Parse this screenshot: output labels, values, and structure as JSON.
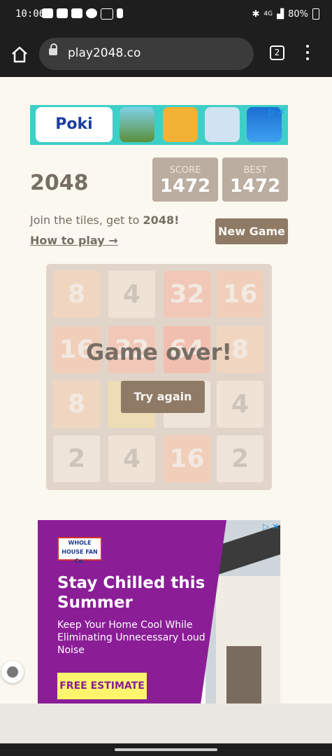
{
  "status": {
    "time": "10:06",
    "battery": "80%",
    "network": "4G"
  },
  "browser": {
    "url": "play2048.co",
    "tab_count": "2"
  },
  "ad_top": {
    "brand": "Poki",
    "adchoices": "▷ ✕"
  },
  "game": {
    "title": "2048",
    "score_label": "SCORE",
    "score": "1472",
    "best_label": "BEST",
    "best": "1472",
    "intro_text": "Join the tiles, get to ",
    "intro_goal": "2048!",
    "how_to": "How to play →",
    "new_game": "New Game",
    "game_over": "Game over!",
    "try_again": "Try again",
    "board": [
      [
        "8",
        "4",
        "32",
        "16"
      ],
      [
        "16",
        "32",
        "64",
        "8"
      ],
      [
        "8",
        "4",
        "2",
        "4"
      ],
      [
        "2",
        "4",
        "16",
        "2"
      ]
    ]
  },
  "ad_bottom": {
    "logo": "WHOLE HOUSE FAN Co.",
    "headline": "Stay Chilled this Summer",
    "body": "Keep Your Home Cool While Eliminating Unnecessary Loud Noise",
    "cta": "FREE ESTIMATE",
    "adchoices": "▷ ✕"
  }
}
